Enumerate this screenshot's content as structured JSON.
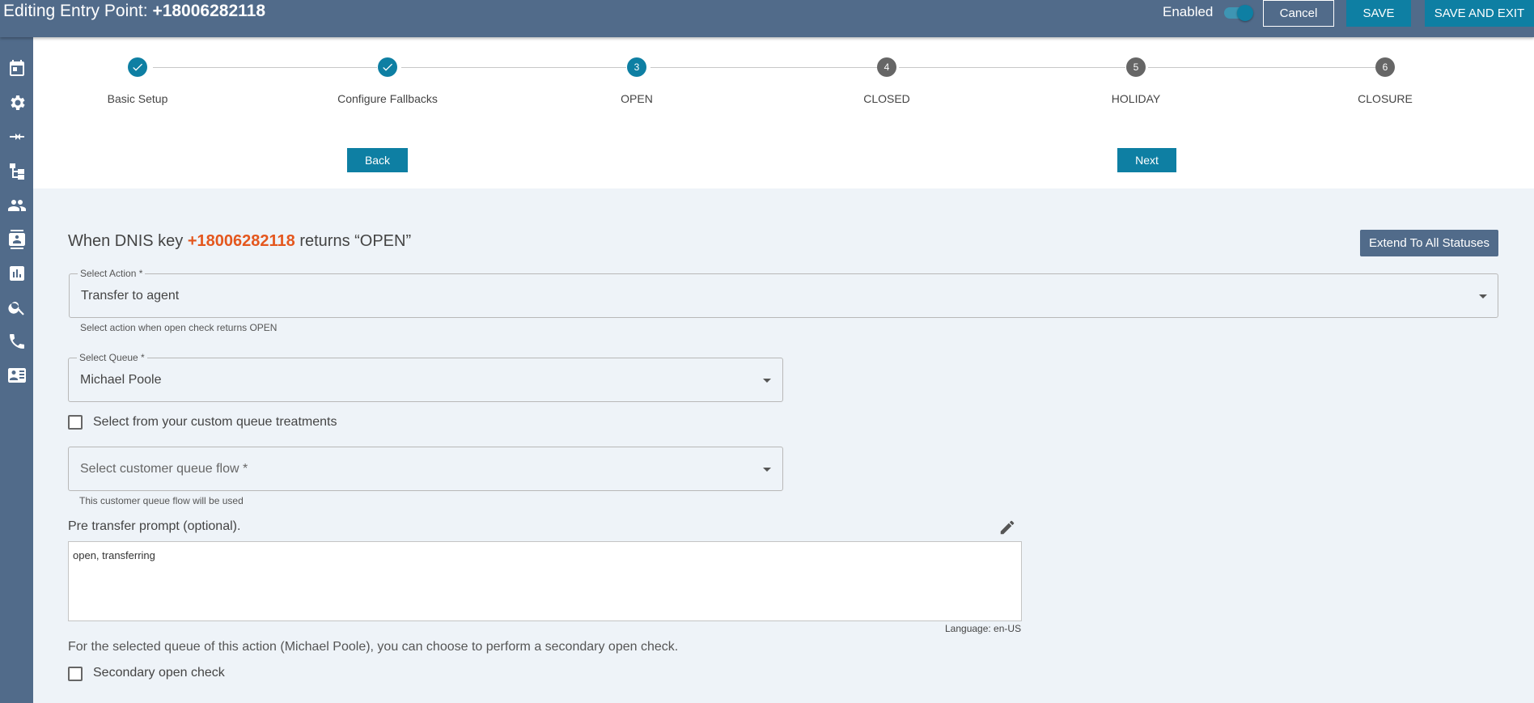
{
  "header": {
    "title_prefix": "Editing Entry Point: ",
    "title_number": "+18006282118",
    "enabled_label": "Enabled",
    "enabled": true,
    "cancel_label": "Cancel",
    "save_label": "SAVE",
    "save_exit_label": "SAVE AND EXIT"
  },
  "sidebar": {
    "items": [
      {
        "icon": "calendar-icon"
      },
      {
        "icon": "gear-icon"
      },
      {
        "icon": "merge-arrows-icon"
      },
      {
        "icon": "hierarchy-icon"
      },
      {
        "icon": "people-icon"
      },
      {
        "icon": "contact-card-icon"
      },
      {
        "icon": "bar-chart-icon"
      },
      {
        "icon": "search-icon"
      },
      {
        "icon": "phone-icon"
      },
      {
        "icon": "id-card-icon"
      }
    ]
  },
  "stepper": {
    "steps": [
      {
        "number": "1",
        "label": "Basic Setup",
        "state": "done"
      },
      {
        "number": "2",
        "label": "Configure Fallbacks",
        "state": "done"
      },
      {
        "number": "3",
        "label": "OPEN",
        "state": "active"
      },
      {
        "number": "4",
        "label": "CLOSED",
        "state": "pending"
      },
      {
        "number": "5",
        "label": "HOLIDAY",
        "state": "pending"
      },
      {
        "number": "6",
        "label": "CLOSURE",
        "state": "pending"
      }
    ],
    "back_label": "Back",
    "next_label": "Next"
  },
  "main": {
    "heading_prefix": "When DNIS key ",
    "heading_dnis": "+18006282118",
    "heading_suffix": " returns “OPEN”",
    "extend_label": "Extend To All Statuses",
    "action_field": {
      "legend": "Select Action *",
      "value": "Transfer to agent",
      "helper": "Select action when open check returns OPEN"
    },
    "queue_field": {
      "legend": "Select Queue *",
      "value": "Michael Poole"
    },
    "custom_queue_checkbox": {
      "label": "Select from your custom queue treatments",
      "checked": false
    },
    "queue_flow_field": {
      "placeholder": "Select customer queue flow *",
      "helper": "This customer queue flow will be used"
    },
    "prompt": {
      "label": "Pre transfer prompt (optional).",
      "text": "open, transferring",
      "language": "Language: en-US"
    },
    "secondary": {
      "description": "For the selected queue of this action (Michael Poole), you can choose to perform a secondary open check.",
      "checkbox_label": "Secondary open check",
      "checked": false
    }
  }
}
